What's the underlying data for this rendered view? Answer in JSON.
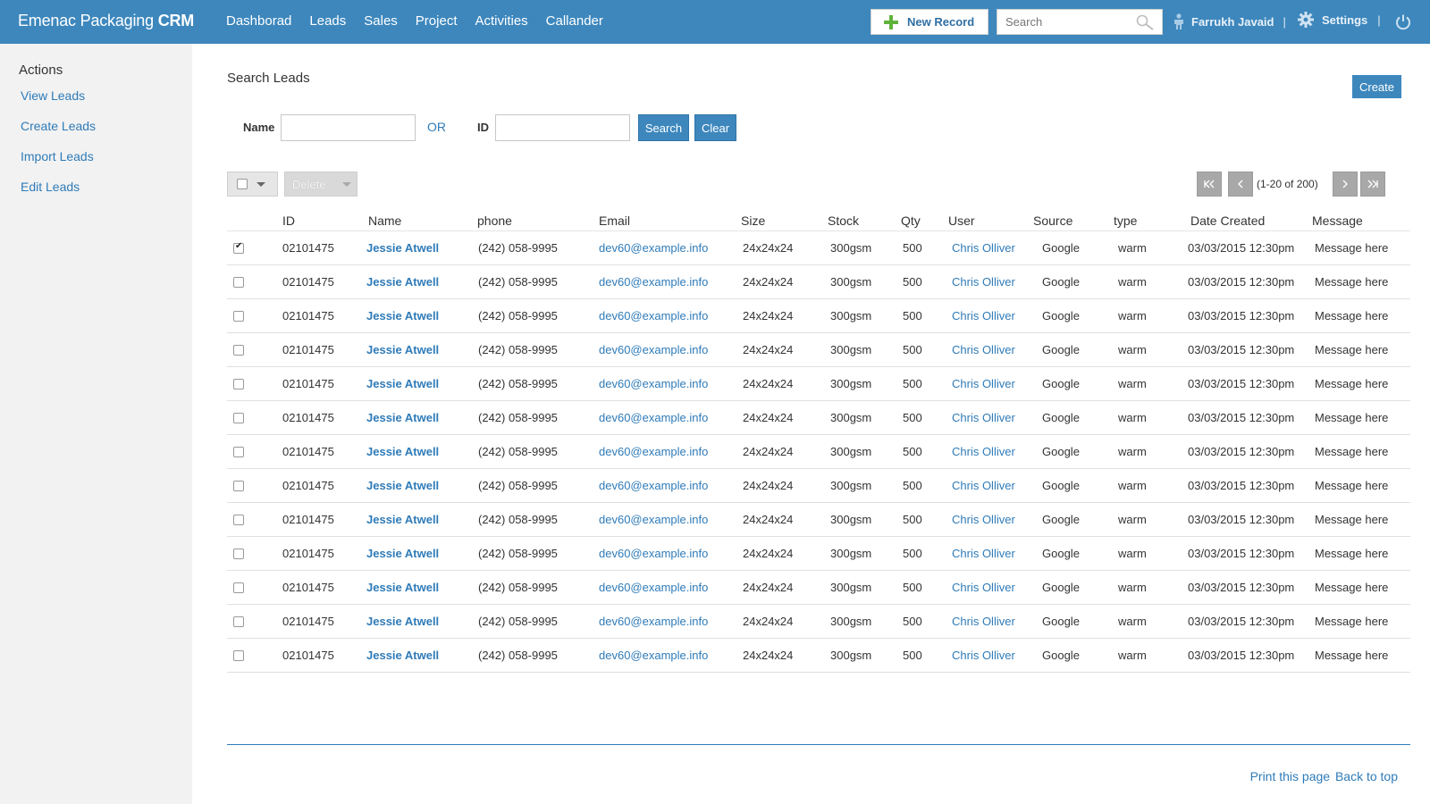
{
  "app": {
    "brand_light": "Emenac Packaging ",
    "brand_bold": "CRM"
  },
  "nav": [
    "Dashborad",
    "Leads",
    "Sales",
    "Project",
    "Activities",
    "Callander"
  ],
  "header": {
    "new_record_label": "New Record",
    "search_placeholder": "Search",
    "user_name": "Farrukh Javaid",
    "separator": "|",
    "settings_label": "Settings"
  },
  "sidebar": {
    "heading": "Actions",
    "items": [
      "View Leads",
      "Create Leads",
      "Import Leads",
      "Edit Leads"
    ]
  },
  "main": {
    "title": "Search Leads",
    "create_label": "Create",
    "form": {
      "name_label": "Name",
      "or_label": "OR",
      "id_label": "ID",
      "name_value": "",
      "id_value": "",
      "search_label": "Search",
      "clear_label": "Clear"
    },
    "toolbar": {
      "delete_label": "Delete",
      "pager_info": "(1-20 of 200)"
    }
  },
  "table": {
    "columns": [
      "ID",
      "Name",
      "phone",
      "Email",
      "Size",
      "Stock",
      "Qty",
      "User",
      "Source",
      "type",
      "Date Created",
      "Message"
    ],
    "rows": [
      {
        "checked": true,
        "id": "02101475",
        "name": "Jessie Atwell",
        "phone": "(242) 058-9995",
        "email": "dev60@example.info",
        "size": "24x24x24",
        "stock": "300gsm",
        "qty": "500",
        "user": "Chris Olliver",
        "source": "Google",
        "type": "warm",
        "date": "03/03/2015 12:30pm",
        "message": "Message here"
      },
      {
        "checked": false,
        "id": "02101475",
        "name": "Jessie Atwell",
        "phone": "(242) 058-9995",
        "email": "dev60@example.info",
        "size": "24x24x24",
        "stock": "300gsm",
        "qty": "500",
        "user": "Chris Olliver",
        "source": "Google",
        "type": "warm",
        "date": "03/03/2015 12:30pm",
        "message": "Message here"
      },
      {
        "checked": false,
        "id": "02101475",
        "name": "Jessie Atwell",
        "phone": "(242) 058-9995",
        "email": "dev60@example.info",
        "size": "24x24x24",
        "stock": "300gsm",
        "qty": "500",
        "user": "Chris Olliver",
        "source": "Google",
        "type": "warm",
        "date": "03/03/2015 12:30pm",
        "message": "Message here"
      },
      {
        "checked": false,
        "id": "02101475",
        "name": "Jessie Atwell",
        "phone": "(242) 058-9995",
        "email": "dev60@example.info",
        "size": "24x24x24",
        "stock": "300gsm",
        "qty": "500",
        "user": "Chris Olliver",
        "source": "Google",
        "type": "warm",
        "date": "03/03/2015 12:30pm",
        "message": "Message here"
      },
      {
        "checked": false,
        "id": "02101475",
        "name": "Jessie Atwell",
        "phone": "(242) 058-9995",
        "email": "dev60@example.info",
        "size": "24x24x24",
        "stock": "300gsm",
        "qty": "500",
        "user": "Chris Olliver",
        "source": "Google",
        "type": "warm",
        "date": "03/03/2015 12:30pm",
        "message": "Message here"
      },
      {
        "checked": false,
        "id": "02101475",
        "name": "Jessie Atwell",
        "phone": "(242) 058-9995",
        "email": "dev60@example.info",
        "size": "24x24x24",
        "stock": "300gsm",
        "qty": "500",
        "user": "Chris Olliver",
        "source": "Google",
        "type": "warm",
        "date": "03/03/2015 12:30pm",
        "message": "Message here"
      },
      {
        "checked": false,
        "id": "02101475",
        "name": "Jessie Atwell",
        "phone": "(242) 058-9995",
        "email": "dev60@example.info",
        "size": "24x24x24",
        "stock": "300gsm",
        "qty": "500",
        "user": "Chris Olliver",
        "source": "Google",
        "type": "warm",
        "date": "03/03/2015 12:30pm",
        "message": "Message here"
      },
      {
        "checked": false,
        "id": "02101475",
        "name": "Jessie Atwell",
        "phone": "(242) 058-9995",
        "email": "dev60@example.info",
        "size": "24x24x24",
        "stock": "300gsm",
        "qty": "500",
        "user": "Chris Olliver",
        "source": "Google",
        "type": "warm",
        "date": "03/03/2015 12:30pm",
        "message": "Message here"
      },
      {
        "checked": false,
        "id": "02101475",
        "name": "Jessie Atwell",
        "phone": "(242) 058-9995",
        "email": "dev60@example.info",
        "size": "24x24x24",
        "stock": "300gsm",
        "qty": "500",
        "user": "Chris Olliver",
        "source": "Google",
        "type": "warm",
        "date": "03/03/2015 12:30pm",
        "message": "Message here"
      },
      {
        "checked": false,
        "id": "02101475",
        "name": "Jessie Atwell",
        "phone": "(242) 058-9995",
        "email": "dev60@example.info",
        "size": "24x24x24",
        "stock": "300gsm",
        "qty": "500",
        "user": "Chris Olliver",
        "source": "Google",
        "type": "warm",
        "date": "03/03/2015 12:30pm",
        "message": "Message here"
      },
      {
        "checked": false,
        "id": "02101475",
        "name": "Jessie Atwell",
        "phone": "(242) 058-9995",
        "email": "dev60@example.info",
        "size": "24x24x24",
        "stock": "300gsm",
        "qty": "500",
        "user": "Chris Olliver",
        "source": "Google",
        "type": "warm",
        "date": "03/03/2015 12:30pm",
        "message": "Message here"
      },
      {
        "checked": false,
        "id": "02101475",
        "name": "Jessie Atwell",
        "phone": "(242) 058-9995",
        "email": "dev60@example.info",
        "size": "24x24x24",
        "stock": "300gsm",
        "qty": "500",
        "user": "Chris Olliver",
        "source": "Google",
        "type": "warm",
        "date": "03/03/2015 12:30pm",
        "message": "Message here"
      },
      {
        "checked": false,
        "id": "02101475",
        "name": "Jessie Atwell",
        "phone": "(242) 058-9995",
        "email": "dev60@example.info",
        "size": "24x24x24",
        "stock": "300gsm",
        "qty": "500",
        "user": "Chris Olliver",
        "source": "Google",
        "type": "warm",
        "date": "03/03/2015 12:30pm",
        "message": "Message here"
      }
    ]
  },
  "footer": {
    "print_label": "Print this page",
    "top_label": "Back to top"
  },
  "icons": {
    "new_record": "plus-icon",
    "search": "magnifier-icon",
    "user": "person-icon",
    "settings": "gear-icon",
    "power": "power-icon",
    "pager": [
      "first-page-icon",
      "prev-page-icon",
      "next-page-icon",
      "last-page-icon"
    ]
  },
  "colors": {
    "header_bg": "#3d87bd",
    "link": "#2f7bb8",
    "sidebar_bg": "#f2f2f2",
    "plus": "#5fb33b"
  }
}
